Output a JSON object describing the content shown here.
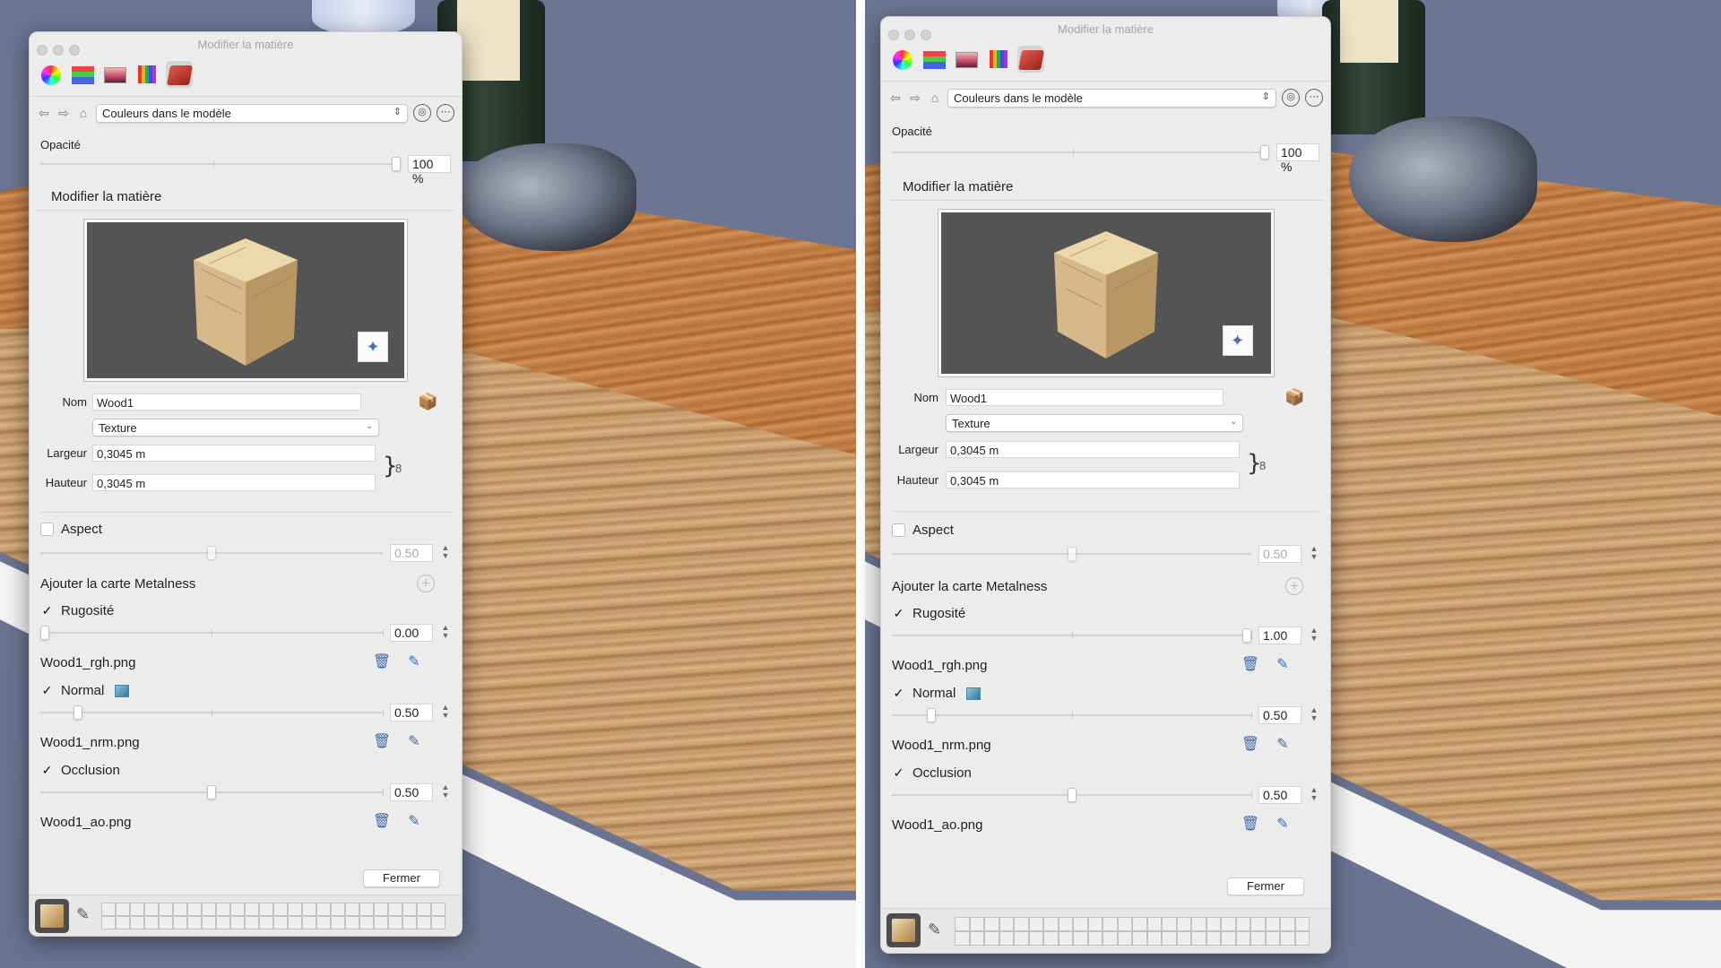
{
  "window": {
    "title": "Modifier la matière"
  },
  "nav": {
    "back_icon": "back-arrow-icon",
    "forward_icon": "forward-arrow-icon",
    "home_icon": "home-icon",
    "collection": "Couleurs dans le modèle"
  },
  "opacity": {
    "label": "Opacité",
    "value_text": "100 %",
    "value": 100
  },
  "section_title": "Modifier la matière",
  "material": {
    "name_label": "Nom",
    "name": "Wood1",
    "type": "Texture",
    "width_label": "Largeur",
    "width": "0,3045 m",
    "height_label": "Hauteur",
    "height": "0,3045 m"
  },
  "aspect": {
    "label": "Aspect",
    "value": "0.50",
    "level": 0.5,
    "checked": false
  },
  "metalness": {
    "label": "Ajouter la carte Metalness"
  },
  "panels": [
    {
      "roughness": {
        "label": "Rugosité",
        "value": "0.00",
        "level": 0.0,
        "file": "Wood1_rgh.png"
      },
      "normal": {
        "label": "Normal",
        "value": "0.50",
        "level": 0.1,
        "file": "Wood1_nrm.png"
      },
      "occlusion": {
        "label": "Occlusion",
        "value": "0.50",
        "level": 0.5,
        "file": "Wood1_ao.png"
      }
    },
    {
      "roughness": {
        "label": "Rugosité",
        "value": "1.00",
        "level": 1.0,
        "file": "Wood1_rgh.png"
      },
      "normal": {
        "label": "Normal",
        "value": "0.50",
        "level": 0.1,
        "file": "Wood1_nrm.png"
      },
      "occlusion": {
        "label": "Occlusion",
        "value": "0.50",
        "level": 0.5,
        "file": "Wood1_ao.png"
      }
    }
  ],
  "close_label": "Fermer",
  "icons": {
    "trash": "trash-icon",
    "edit": "edit-icon",
    "add": "plus-circle-icon",
    "eyedropper": "eyedropper-icon",
    "sparkle": "sparkle-icon",
    "link": "link-chain-icon"
  }
}
